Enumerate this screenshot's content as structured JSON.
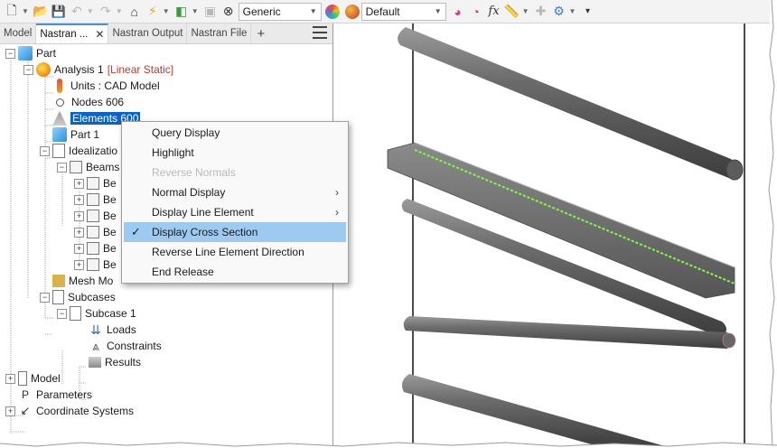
{
  "toolbar": {
    "style_combo": "Generic",
    "appearance_combo": "Default",
    "fx_label": "fx"
  },
  "tabs": [
    {
      "label": "Model"
    },
    {
      "label": "Nastran ...",
      "active": true
    },
    {
      "label": "Nastran Output"
    },
    {
      "label": "Nastran File"
    }
  ],
  "tabs_add": "+",
  "tree": {
    "part": "Part",
    "analysis": "Analysis 1",
    "analysis_type": "[Linear Static]",
    "units": "Units : CAD Model",
    "nodes": "Nodes 606",
    "elements": "Elements 600",
    "part1": "Part 1",
    "idealization": "Idealizatio",
    "beams": "Beams",
    "beam_items": [
      "Be",
      "Be",
      "Be",
      "Be",
      "Be",
      "Be"
    ],
    "mesh": "Mesh Mo",
    "subcases": "Subcases",
    "subcase1": "Subcase 1",
    "loads": "Loads",
    "constraints": "Constraints",
    "results": "Results",
    "model": "Model",
    "parameters": "Parameters",
    "coordinate_systems": "Coordinate Systems"
  },
  "context_menu": {
    "items": [
      {
        "label": "Query Display"
      },
      {
        "label": "Highlight"
      },
      {
        "label": "Reverse Normals",
        "disabled": true
      },
      {
        "label": "Normal Display",
        "submenu": true
      },
      {
        "label": "Display Line Element",
        "submenu": true
      },
      {
        "label": "Display Cross Section",
        "checked": true,
        "highlighted": true
      },
      {
        "label": "Reverse Line Element Direction"
      },
      {
        "label": "End Release"
      }
    ]
  },
  "colors": {
    "selection": "#0a64c8",
    "menu_highlight": "#9ccaf0",
    "beam_gray": "#6e6e6e",
    "beam_line": "#7cff3a"
  }
}
